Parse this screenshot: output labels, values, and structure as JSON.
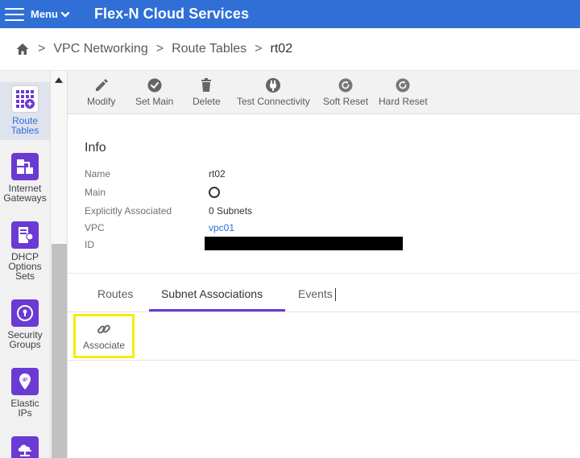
{
  "topbar": {
    "menu_label": "Menu",
    "app_title": "Flex-N Cloud Services",
    "background": "#2f6fd6"
  },
  "breadcrumb": {
    "items": [
      "VPC Networking",
      "Route Tables",
      "rt02"
    ],
    "separator": ">"
  },
  "rail": {
    "items": [
      {
        "label_lines": [
          "Route",
          "Tables"
        ],
        "icon": "route-tables-icon",
        "active": true
      },
      {
        "label_lines": [
          "Internet",
          "Gateways"
        ],
        "icon": "internet-gateways-icon"
      },
      {
        "label_lines": [
          "DHCP",
          "Options",
          "Sets"
        ],
        "icon": "dhcp-options-icon"
      },
      {
        "label_lines": [
          "Security",
          "Groups"
        ],
        "icon": "security-groups-icon"
      },
      {
        "label_lines": [
          "Elastic",
          "IPs"
        ],
        "icon": "elastic-ips-icon"
      },
      {
        "label_lines": [],
        "icon": "cloud-network-icon"
      }
    ],
    "accent": "#6a3ad3"
  },
  "toolbar": {
    "modify": "Modify",
    "set_main": "Set Main",
    "delete": "Delete",
    "test_connectivity": "Test Connectivity",
    "soft_reset": "Soft Reset",
    "hard_reset": "Hard Reset"
  },
  "info": {
    "title": "Info",
    "name_label": "Name",
    "name_value": "rt02",
    "main_label": "Main",
    "explicit_label": "Explicitly Associated",
    "explicit_value": "0 Subnets",
    "vpc_label": "VPC",
    "vpc_value": "vpc01",
    "id_label": "ID"
  },
  "tabs": {
    "routes": "Routes",
    "subnet_associations": "Subnet Associations",
    "events": "Events",
    "active": "subnet_associations"
  },
  "associate": {
    "label": "Associate",
    "highlight": "#f2ee00"
  }
}
